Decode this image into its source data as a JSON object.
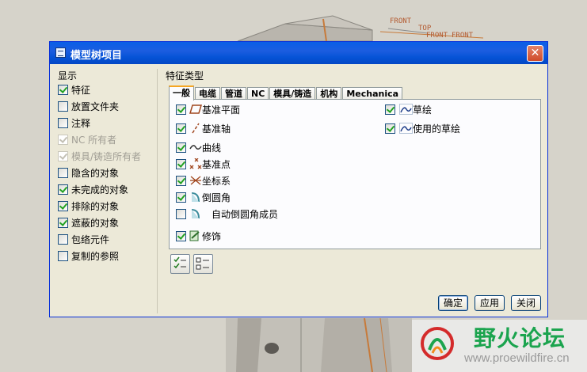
{
  "viewport": {
    "labels": [
      "FRONT",
      "TOP",
      "FRONT",
      "FRONT"
    ]
  },
  "watermark": {
    "title": "野火论坛",
    "url": "www.proewildfire.cn"
  },
  "dialog": {
    "title": "模型树项目",
    "close_label": "✕",
    "display_label": "显示",
    "display_items": [
      {
        "label": "特征",
        "checked": true,
        "disabled": false
      },
      {
        "label": "放置文件夹",
        "checked": false,
        "disabled": false
      },
      {
        "label": "注释",
        "checked": false,
        "disabled": false
      },
      {
        "label": "NC 所有者",
        "checked": true,
        "disabled": true
      },
      {
        "label": "模具/铸造所有者",
        "checked": true,
        "disabled": true
      },
      {
        "label": "隐含的对象",
        "checked": false,
        "disabled": false
      },
      {
        "label": "未完成的对象",
        "checked": true,
        "disabled": false
      },
      {
        "label": "排除的对象",
        "checked": true,
        "disabled": false
      },
      {
        "label": "遮蔽的对象",
        "checked": true,
        "disabled": false
      },
      {
        "label": "包络元件",
        "checked": false,
        "disabled": false
      },
      {
        "label": "复制的参照",
        "checked": false,
        "disabled": false
      }
    ],
    "feature_types_label": "特征类型",
    "tabs": [
      "一般",
      "电缆",
      "管道",
      "NC",
      "模具/铸造",
      "机构",
      "Mechanica"
    ],
    "active_tab": 0,
    "features_left": [
      {
        "label": "基准平面",
        "checked": true,
        "icon": "datum-plane-icon"
      },
      {
        "label": "基准轴",
        "checked": true,
        "icon": "datum-axis-icon"
      },
      {
        "label": "曲线",
        "checked": true,
        "icon": "curve-icon"
      },
      {
        "label": "基准点",
        "checked": true,
        "icon": "datum-point-icon"
      },
      {
        "label": "坐标系",
        "checked": true,
        "icon": "coordinate-system-icon"
      },
      {
        "label": "倒圆角",
        "checked": true,
        "icon": "round-icon"
      },
      {
        "label": "自动倒圆角成员",
        "checked": false,
        "icon": "auto-round-member-icon"
      },
      {
        "label": "修饰",
        "checked": true,
        "icon": "cosmetic-icon"
      }
    ],
    "features_right": [
      {
        "label": "草绘",
        "checked": true,
        "icon": "sketch-icon"
      },
      {
        "label": "使用的草绘",
        "checked": true,
        "icon": "used-sketch-icon"
      }
    ],
    "buttons": {
      "ok": "确定",
      "apply": "应用",
      "close": "关闭"
    },
    "colors": {
      "title_bar": "#0553d6",
      "dialog_bg": "#ece9d8",
      "check_green": "#21a121",
      "tab_active_accent": "#f5a623",
      "watermark_green": "#1ba44e"
    }
  }
}
